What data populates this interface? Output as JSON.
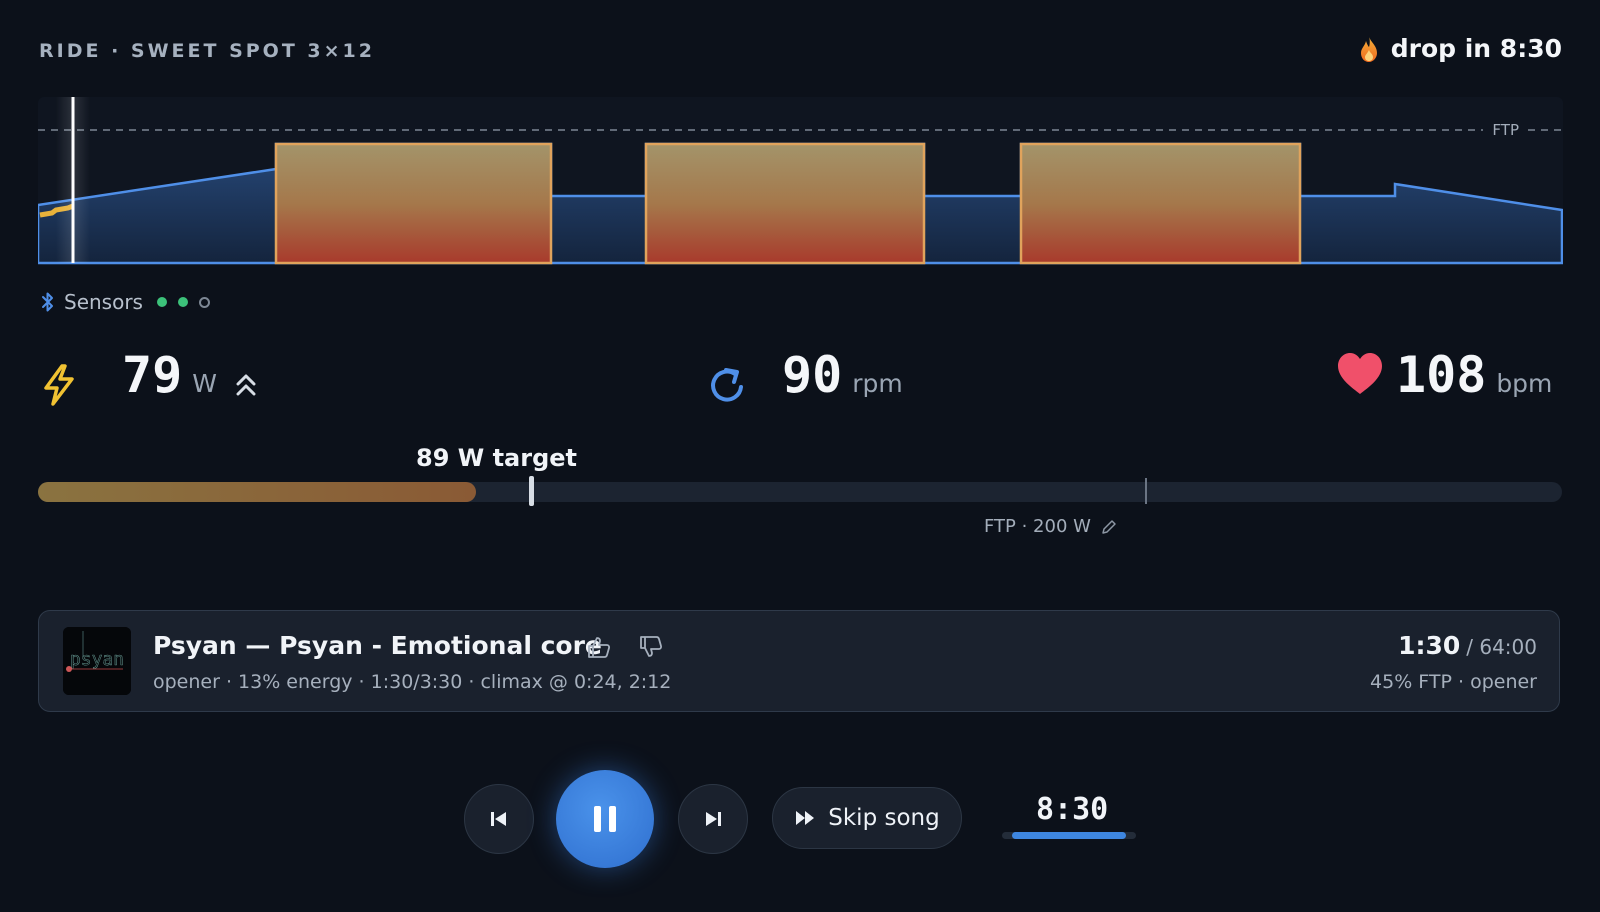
{
  "header": {
    "workout_title": "RIDE · SWEET SPOT 3×12",
    "drop_text": "drop in 8:30",
    "drop_icon": "flame-icon"
  },
  "profile": {
    "ftp_line_label": "FTP",
    "colors": {
      "base": "#4f8fe8",
      "interval_top": "#e0a35c",
      "interval_bottom": "#c0392b",
      "ride_trace": "#e8b23a"
    }
  },
  "sensors": {
    "label": "Sensors",
    "icon": "bluetooth-icon",
    "states": [
      "connected",
      "connected",
      "disconnected"
    ]
  },
  "metrics": {
    "power": {
      "value": "79",
      "unit": "W",
      "icon": "lightning-icon",
      "trend_icon": "double-chevron-up-icon"
    },
    "cadence": {
      "value": "90",
      "unit": "rpm",
      "icon": "refresh-icon"
    },
    "heart_rate": {
      "value": "108",
      "unit": "bpm",
      "icon": "heart-icon"
    }
  },
  "power_bar": {
    "target_label": "89 W target",
    "current_watts": 79,
    "target_watts": 89,
    "ftp_watts": 200,
    "max_watts": 275,
    "ftp_label": "FTP · 200 W",
    "edit_icon": "pencil-icon"
  },
  "now_playing": {
    "title": "Psyan — Psyan - Emotional core",
    "meta": "opener · 13% energy · 1:30/3:30 · climax @ 0:24, 2:12",
    "elapsed": "1:30",
    "total": "/ 64:00",
    "zone": "45% FTP · opener",
    "album_art_text": "psyan"
  },
  "controls": {
    "skip_song_label": "Skip song",
    "timer": "8:30",
    "timer_progress": 0.85,
    "accent": "#3e86e0"
  }
}
